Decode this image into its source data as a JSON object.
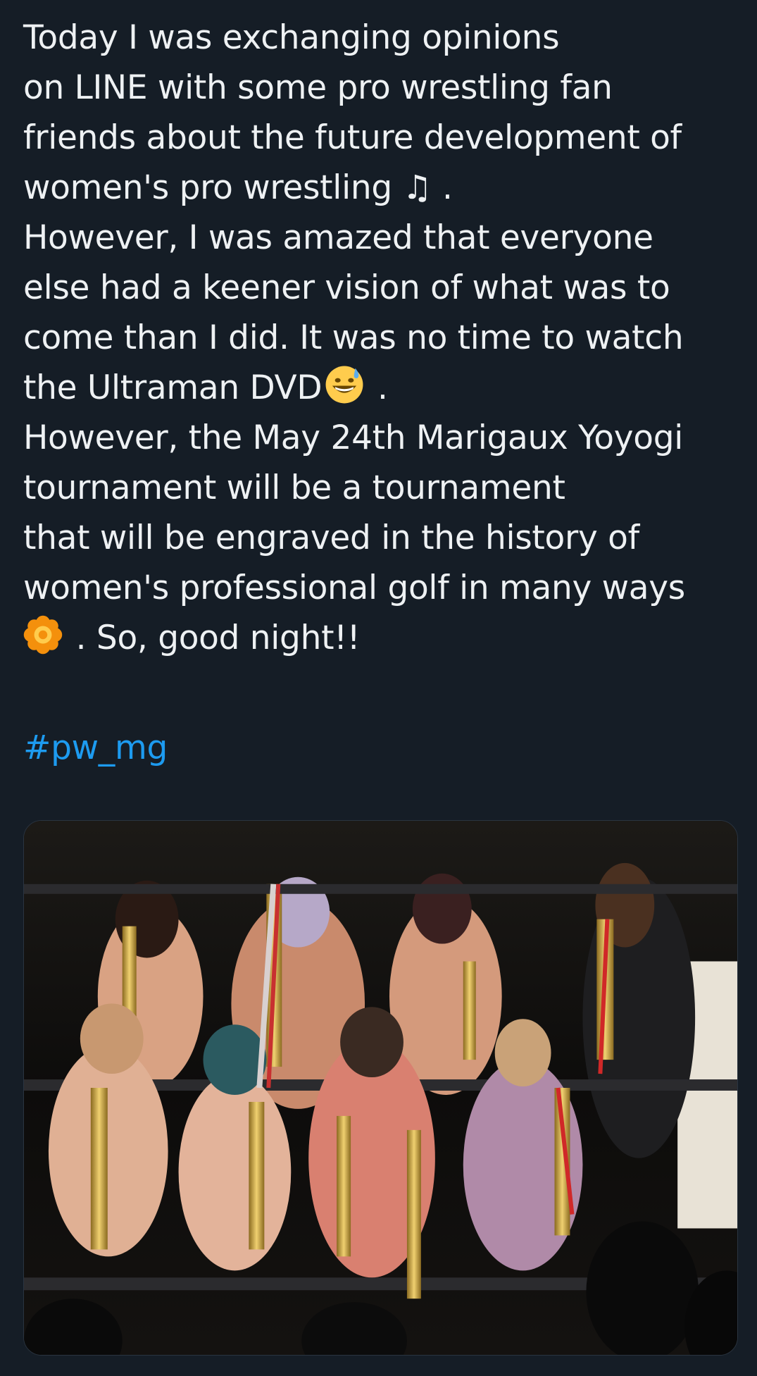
{
  "post": {
    "lines": [
      "Today I was exchanging opinions",
      "on LINE with some pro wrestling fan",
      "friends about the future development of",
      "women's pro wrestling ♫ .",
      "However, I was amazed that everyone",
      "else had a keener vision of what was to",
      "come than I did. It was no time to watch",
      "the Ultraman DVD",
      " .",
      "However, the May 24th Marigaux Yoyogi",
      "tournament will be a tournament",
      "that will be engraved in the history of",
      "women's professional golf in many ways",
      " . So, good night!!"
    ],
    "hashtag": "#pw_mg",
    "emojis": {
      "sweat_smile": "grinning-face-with-sweat-icon",
      "flower": "orange-flower-icon"
    }
  },
  "media": {
    "alt_subject": "wrestlers-with-trophies-photo"
  },
  "colors": {
    "background": "#151d26",
    "text": "#eef1f3",
    "link": "#1d9bf0"
  }
}
